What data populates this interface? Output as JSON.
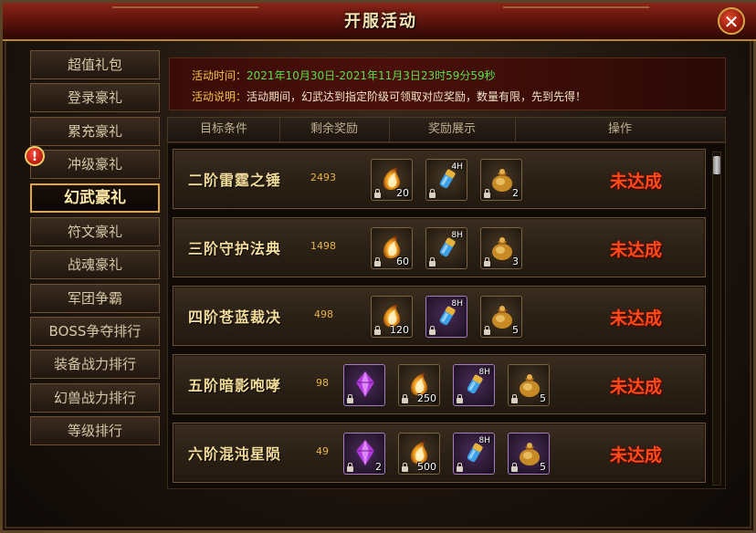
{
  "window": {
    "title": "开服活动",
    "close_label": "✕"
  },
  "sidebar": {
    "tabs": [
      {
        "label": "超值礼包",
        "active": false
      },
      {
        "label": "登录豪礼",
        "active": false
      },
      {
        "label": "累充豪礼",
        "active": false
      },
      {
        "label": "冲级豪礼",
        "active": false
      },
      {
        "label": "幻武豪礼",
        "active": true
      },
      {
        "label": "符文豪礼",
        "active": false
      },
      {
        "label": "战魂豪礼",
        "active": false
      },
      {
        "label": "军团争霸",
        "active": false
      },
      {
        "label": "BOSS争夺排行",
        "active": false
      },
      {
        "label": "装备战力排行",
        "active": false
      },
      {
        "label": "幻兽战力排行",
        "active": false
      },
      {
        "label": "等级排行",
        "active": false
      }
    ],
    "alert_mark": "!"
  },
  "info": {
    "time_label": "活动时间：",
    "time_value": "2021年10月30日-2021年11月3日23时59分59秒",
    "desc_label": "活动说明：",
    "desc_value": "活动期间，幻武达到指定阶级可领取对应奖励，数量有限，先到先得！"
  },
  "table": {
    "headers": [
      "目标条件",
      "剩余奖励",
      "奖励展示",
      "操作"
    ],
    "rows": [
      {
        "title": "二阶雷霆之锤",
        "remaining": "2493",
        "status": "未达成",
        "items": [
          {
            "icon": "flame-egg-icon",
            "count": "20",
            "duration": "",
            "rarity": "orange"
          },
          {
            "icon": "potion-vial-icon",
            "count": "",
            "duration": "4H",
            "rarity": "orange"
          },
          {
            "icon": "gold-bag-icon",
            "count": "2",
            "duration": "",
            "rarity": "orange"
          }
        ]
      },
      {
        "title": "三阶守护法典",
        "remaining": "1498",
        "status": "未达成",
        "items": [
          {
            "icon": "flame-egg-icon",
            "count": "60",
            "duration": "",
            "rarity": "orange"
          },
          {
            "icon": "potion-vial-icon",
            "count": "",
            "duration": "8H",
            "rarity": "orange"
          },
          {
            "icon": "gold-bag-icon",
            "count": "3",
            "duration": "",
            "rarity": "orange"
          }
        ]
      },
      {
        "title": "四阶苍蓝裁决",
        "remaining": "498",
        "status": "未达成",
        "items": [
          {
            "icon": "flame-egg-icon",
            "count": "120",
            "duration": "",
            "rarity": "orange"
          },
          {
            "icon": "potion-vial-icon",
            "count": "",
            "duration": "8H",
            "rarity": "purple"
          },
          {
            "icon": "gold-bag-icon",
            "count": "5",
            "duration": "",
            "rarity": "orange"
          }
        ]
      },
      {
        "title": "五阶暗影咆哮",
        "remaining": "98",
        "status": "未达成",
        "items": [
          {
            "icon": "purple-crystal-icon",
            "count": "",
            "duration": "",
            "rarity": "purple"
          },
          {
            "icon": "flame-egg-icon",
            "count": "250",
            "duration": "",
            "rarity": "orange"
          },
          {
            "icon": "potion-vial-icon",
            "count": "",
            "duration": "8H",
            "rarity": "purple"
          },
          {
            "icon": "gold-bag-icon",
            "count": "5",
            "duration": "",
            "rarity": "orange"
          }
        ]
      },
      {
        "title": "六阶混沌星陨",
        "remaining": "49",
        "status": "未达成",
        "items": [
          {
            "icon": "purple-crystal-icon",
            "count": "2",
            "duration": "",
            "rarity": "purple"
          },
          {
            "icon": "flame-egg-icon",
            "count": "500",
            "duration": "",
            "rarity": "orange"
          },
          {
            "icon": "potion-vial-icon",
            "count": "",
            "duration": "8H",
            "rarity": "purple"
          },
          {
            "icon": "gold-bag-icon",
            "count": "5",
            "duration": "",
            "rarity": "purple"
          }
        ]
      }
    ]
  },
  "colors": {
    "accent_gold": "#e0a83c",
    "status_red": "#ff4a1a",
    "time_green": "#59e04a",
    "label_yellow": "#f3c34a"
  }
}
